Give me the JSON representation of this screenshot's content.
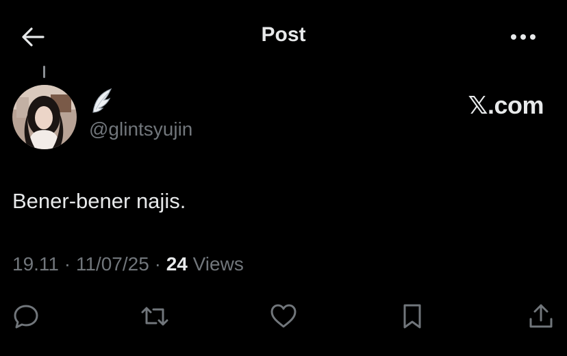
{
  "header": {
    "title": "Post",
    "back_icon": "arrow-left-icon",
    "more_icon": "more-horizontal-icon"
  },
  "author": {
    "display_name_icon": "wing-emoji-icon",
    "handle": "@glintsyujin",
    "avatar_icon": "avatar-photo"
  },
  "brand": {
    "label": "𝕏.com"
  },
  "post": {
    "text": "Bener-bener najis.",
    "time": "19.11",
    "separator": "·",
    "date": "11/07/25",
    "views_count": "24",
    "views_label": "Views"
  },
  "actions": {
    "reply_icon": "reply-bubble-icon",
    "repost_icon": "repost-icon",
    "like_icon": "heart-icon",
    "bookmark_icon": "bookmark-icon",
    "share_icon": "share-icon"
  },
  "colors": {
    "background": "#000000",
    "primary_text": "#e7e9ea",
    "secondary_text": "#71767b"
  }
}
